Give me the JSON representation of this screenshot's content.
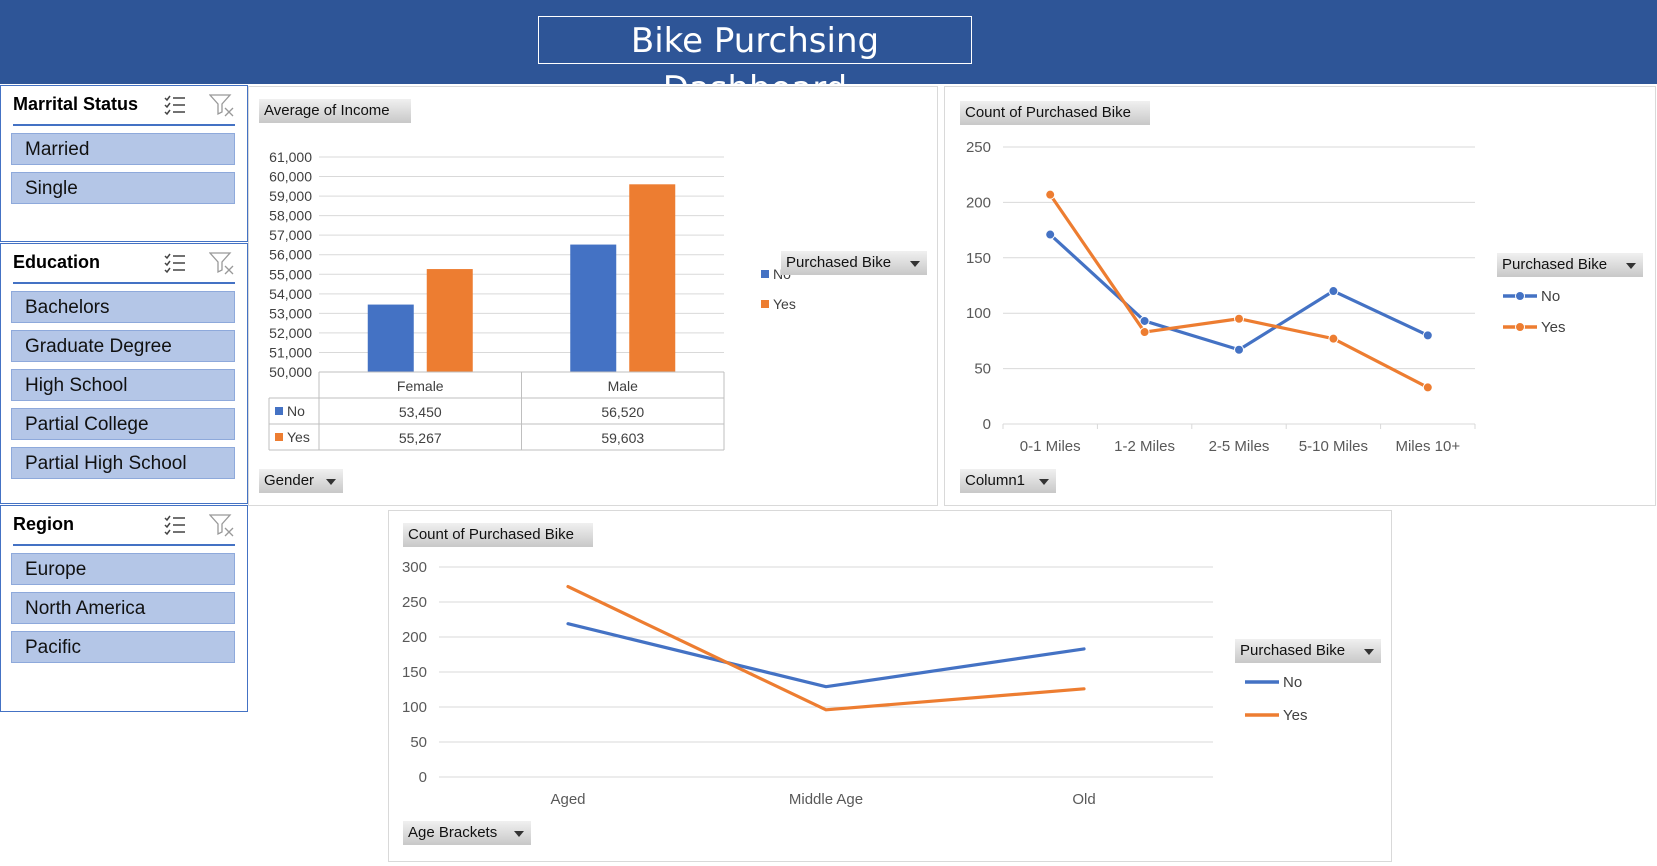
{
  "header": {
    "title": "Bike Purchsing Dashboard"
  },
  "slicers": [
    {
      "title": "Marrital Status",
      "items": [
        "Married",
        "Single"
      ]
    },
    {
      "title": "Education",
      "items": [
        "Bachelors",
        "Graduate Degree",
        "High School",
        "Partial College",
        "Partial High School"
      ]
    },
    {
      "title": "Region",
      "items": [
        "Europe",
        "North America",
        "Pacific"
      ]
    }
  ],
  "charts": {
    "income": {
      "value_button": "Average of Income",
      "axis_button": "Gender",
      "legend_button": "Purchased Bike"
    },
    "commute": {
      "value_button": "Count of Purchased Bike",
      "axis_button": "Column1",
      "legend_button": "Purchased Bike"
    },
    "age": {
      "value_button": "Count of Purchased Bike",
      "axis_button": "Age Brackets",
      "legend_button": "Purchased Bike"
    }
  },
  "colors": {
    "banner": "#2e5597",
    "no": "#4472c4",
    "yes": "#ed7d31",
    "slicer_item": "#b4c6e7"
  },
  "chart_data": [
    {
      "type": "bar",
      "categories": [
        "Female",
        "Male"
      ],
      "series": [
        {
          "name": "No",
          "values": [
            53450,
            56520
          ]
        },
        {
          "name": "Yes",
          "values": [
            55267,
            59603
          ]
        }
      ],
      "data_table": [
        [
          "53,450",
          "56,520"
        ],
        [
          "55,267",
          "59,603"
        ]
      ],
      "ylim": [
        50000,
        61000
      ],
      "yticks": [
        "50,000",
        "51,000",
        "52,000",
        "53,000",
        "54,000",
        "55,000",
        "56,000",
        "57,000",
        "58,000",
        "59,000",
        "60,000",
        "61,000"
      ],
      "grid": true,
      "legend": "right"
    },
    {
      "type": "line",
      "categories": [
        "0-1 Miles",
        "1-2 Miles",
        "2-5 Miles",
        "5-10 Miles",
        "Miles 10+"
      ],
      "series": [
        {
          "name": "No",
          "values": [
            171,
            93,
            67,
            120,
            80
          ]
        },
        {
          "name": "Yes",
          "values": [
            207,
            83,
            95,
            77,
            33
          ]
        }
      ],
      "ylim": [
        0,
        250
      ],
      "yticks": [
        "0",
        "50",
        "100",
        "150",
        "200",
        "250"
      ],
      "markers": true,
      "grid": true,
      "legend": "right"
    },
    {
      "type": "line",
      "categories": [
        "Aged",
        "Middle Age",
        "Old"
      ],
      "series": [
        {
          "name": "No",
          "values": [
            219,
            129,
            183
          ]
        },
        {
          "name": "Yes",
          "values": [
            272,
            96,
            126
          ]
        }
      ],
      "ylim": [
        0,
        300
      ],
      "yticks": [
        "0",
        "50",
        "100",
        "150",
        "200",
        "250",
        "300"
      ],
      "markers": false,
      "grid": true,
      "legend": "right"
    }
  ]
}
